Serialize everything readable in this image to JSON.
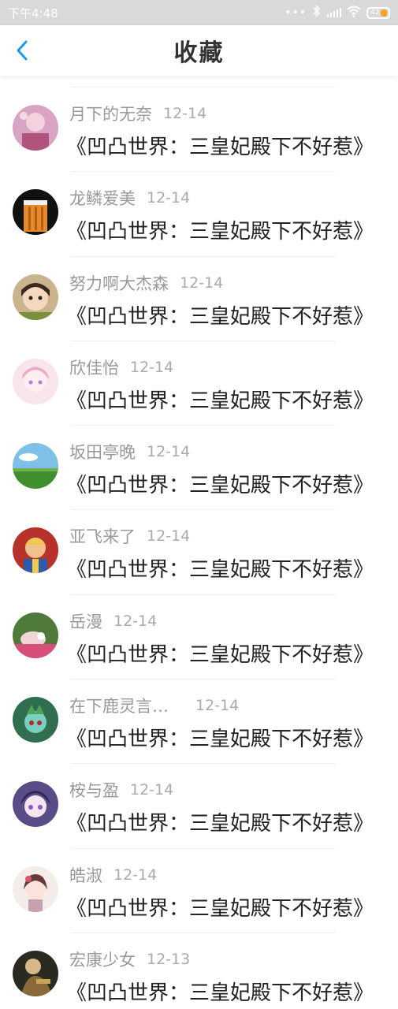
{
  "status_bar": {
    "time": "下午4:48",
    "battery": "42",
    "icons": [
      "more-dots-icon",
      "bluetooth-icon",
      "signal-icon",
      "wifi-icon",
      "battery-icon"
    ]
  },
  "header": {
    "title": "收藏",
    "back_icon": "chevron-left-icon",
    "accent": "#1a9be8"
  },
  "favorites": [
    {
      "user": "月下的无奈",
      "date": "12-14",
      "title": "《凹凸世界：三皇妃殿下不好惹》"
    },
    {
      "user": "龙鳞爱美",
      "date": "12-14",
      "title": "《凹凸世界：三皇妃殿下不好惹》"
    },
    {
      "user": "努力啊大杰森",
      "date": "12-14",
      "title": "《凹凸世界：三皇妃殿下不好惹》"
    },
    {
      "user": "欣佳怡",
      "date": "12-14",
      "title": "《凹凸世界：三皇妃殿下不好惹》"
    },
    {
      "user": "坂田亭晚",
      "date": "12-14",
      "title": "《凹凸世界：三皇妃殿下不好惹》"
    },
    {
      "user": "亚飞来了",
      "date": "12-14",
      "title": "《凹凸世界：三皇妃殿下不好惹》"
    },
    {
      "user": "岳漫",
      "date": "12-14",
      "title": "《凹凸世界：三皇妃殿下不好惹》"
    },
    {
      "user": "在下鹿灵言…",
      "date": "12-14",
      "title": "《凹凸世界：三皇妃殿下不好惹》"
    },
    {
      "user": "桉与盈",
      "date": "12-14",
      "title": "《凹凸世界：三皇妃殿下不好惹》"
    },
    {
      "user": "皓淑",
      "date": "12-14",
      "title": "《凹凸世界：三皇妃殿下不好惹》"
    },
    {
      "user": "宏康少女",
      "date": "12-13",
      "title": "《凹凸世界：三皇妃殿下不好惹》"
    }
  ]
}
